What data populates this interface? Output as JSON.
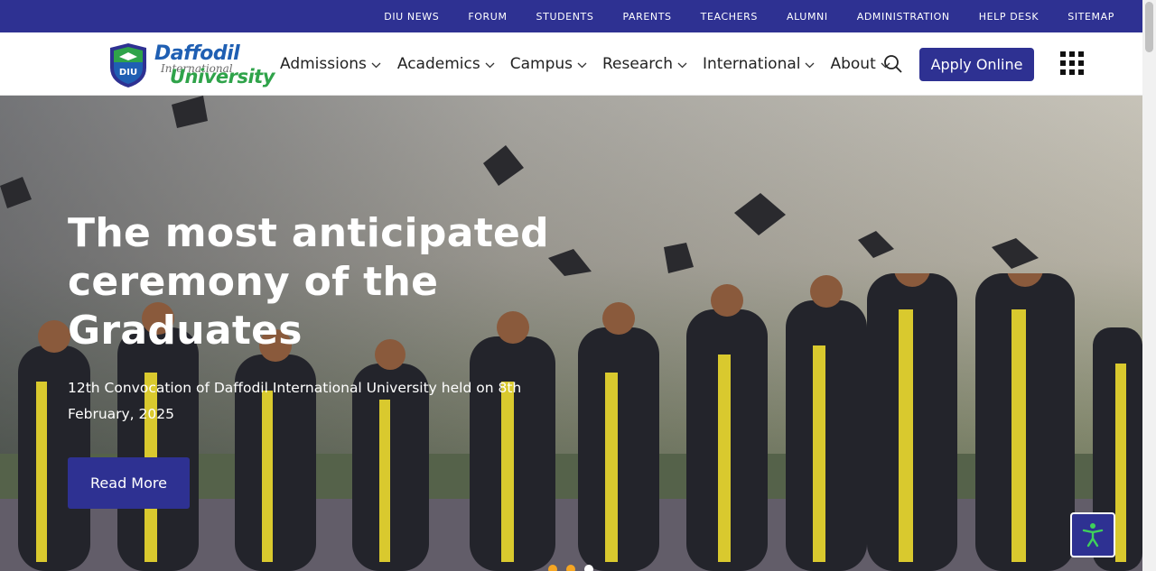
{
  "topbar": {
    "links": [
      "DIU NEWS",
      "FORUM",
      "STUDENTS",
      "PARENTS",
      "TEACHERS",
      "ALUMNI",
      "ADMINISTRATION",
      "HELP DESK",
      "SITEMAP"
    ]
  },
  "logo": {
    "badge_text": "DIU",
    "word1": "Daffodil",
    "word2": "International",
    "word3": "University"
  },
  "nav": {
    "items": [
      "Admissions",
      "Academics",
      "Campus",
      "Research",
      "International",
      "About"
    ],
    "apply_label": "Apply Online",
    "icons": {
      "search": "search-icon",
      "apps": "apps-grid-icon",
      "dropdown": "chevron-down-icon"
    }
  },
  "hero": {
    "title": "The most anticipated ceremony of the Graduates",
    "subtitle": "12th Convocation of Daffodil International University held on 8th February, 2025",
    "button_label": "Read More",
    "slides": [
      {
        "color": "#f5a623",
        "active": false
      },
      {
        "color": "#f5a623",
        "active": false
      },
      {
        "color": "#ffffff",
        "active": true
      }
    ]
  },
  "accessibility": {
    "icon": "accessibility-icon"
  },
  "colors": {
    "brand": "#2e3192",
    "logo_blue": "#1f5fb3",
    "logo_green": "#2fa34a"
  }
}
